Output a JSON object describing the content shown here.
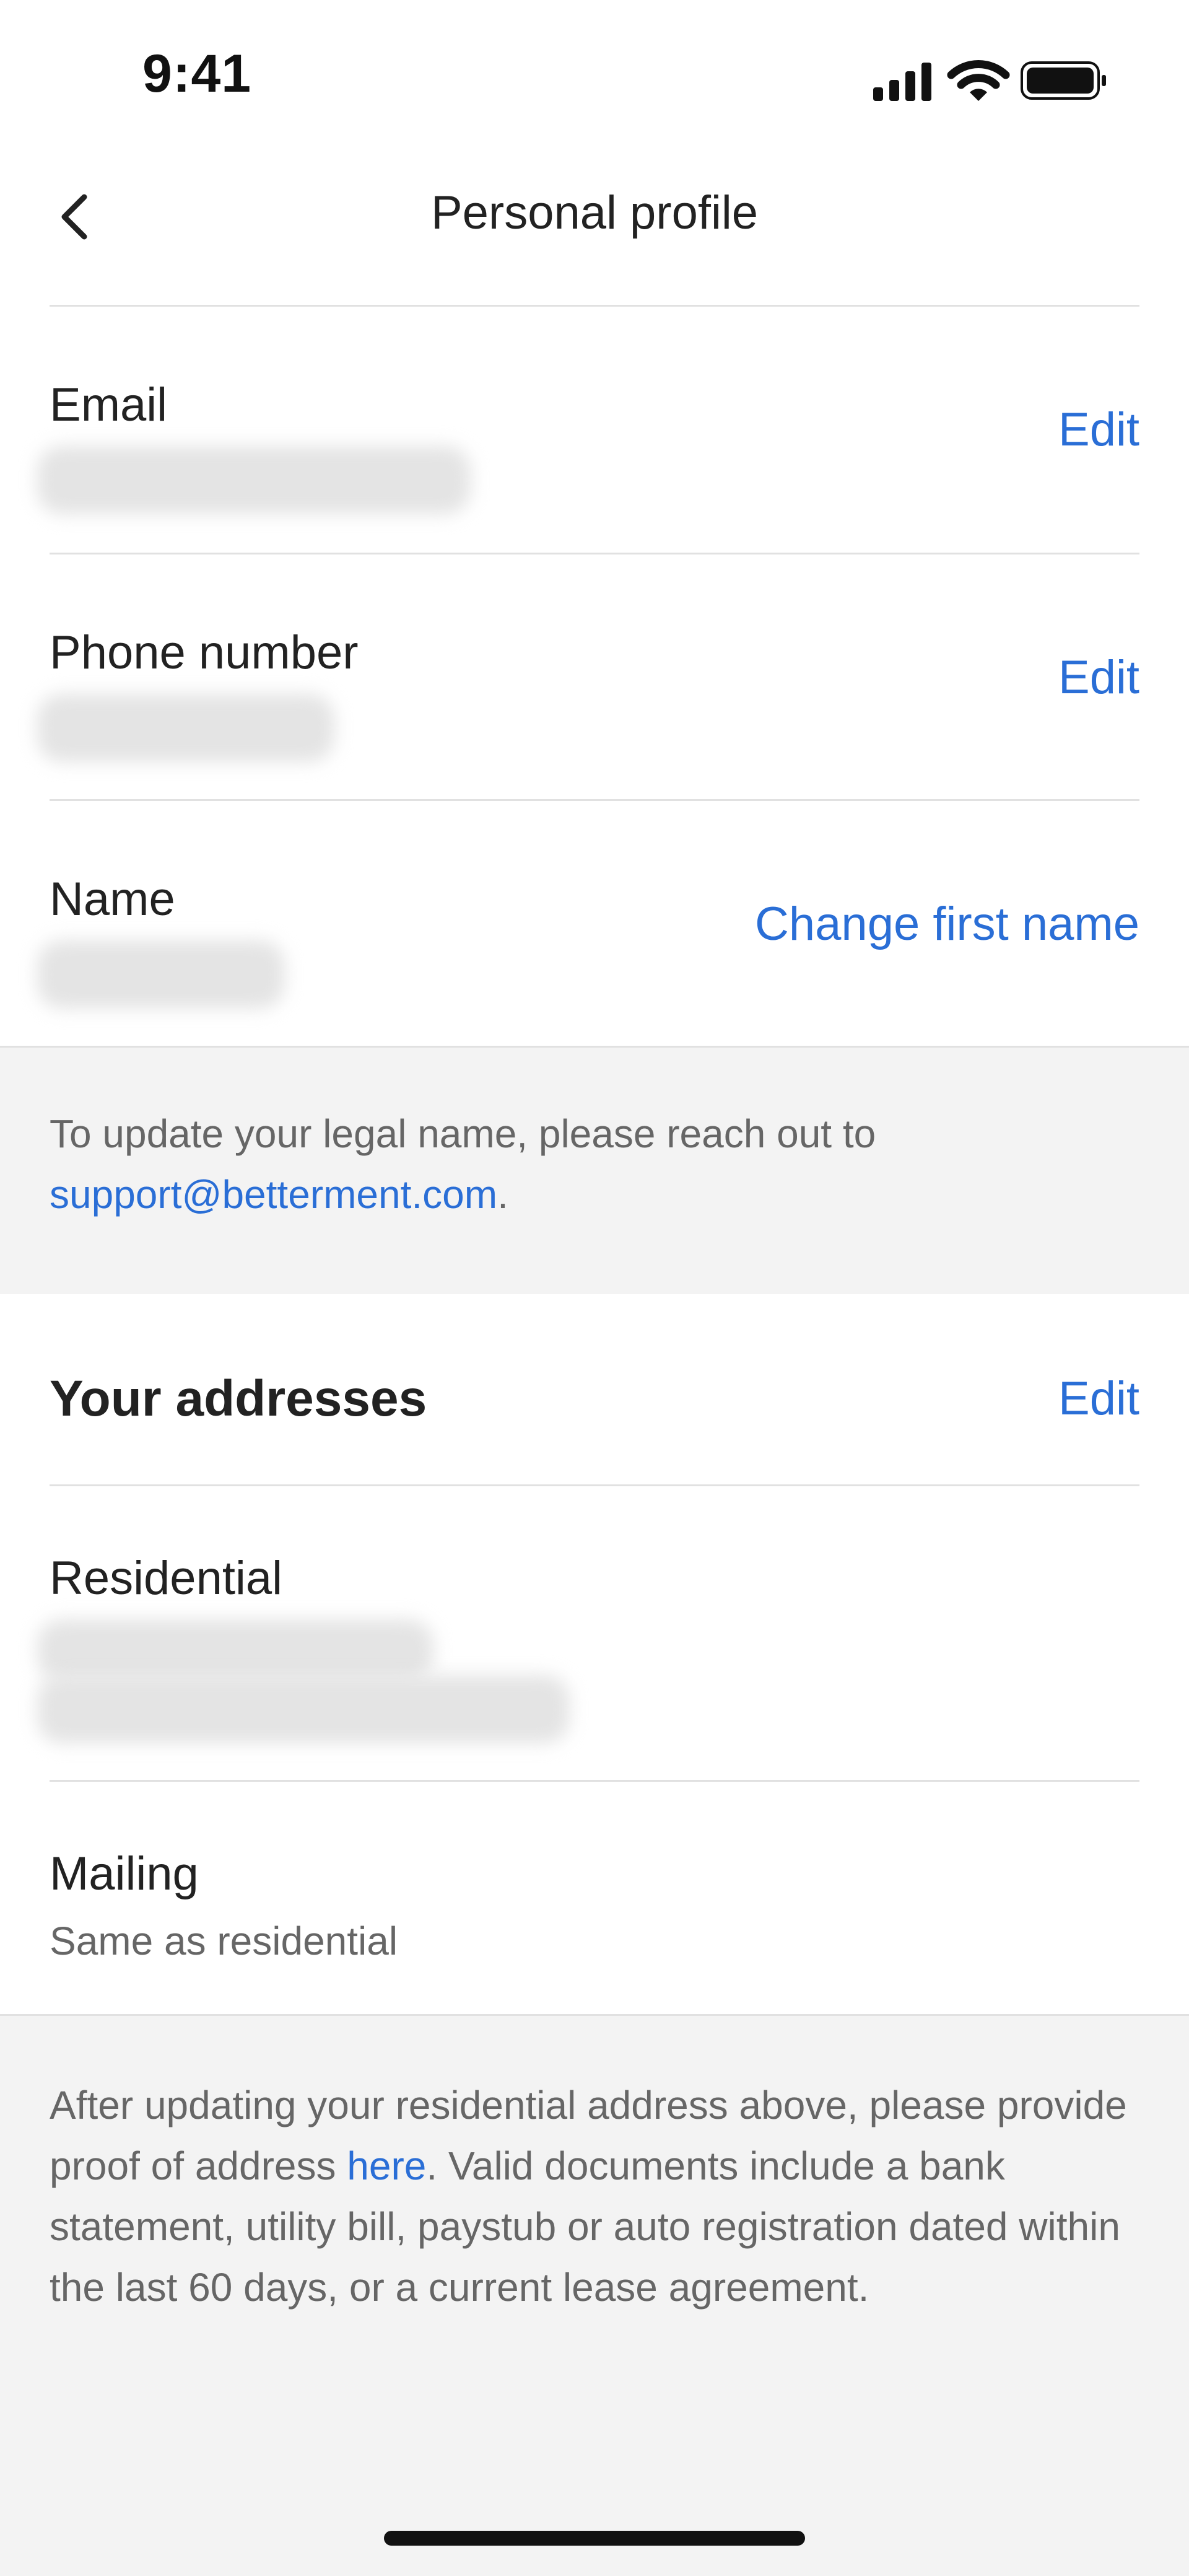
{
  "status_bar": {
    "time": "9:41",
    "icons": [
      "cellular-signal-icon",
      "wifi-icon",
      "battery-icon"
    ]
  },
  "header": {
    "title": "Personal profile",
    "back_icon": "chevron-left-icon"
  },
  "profile": {
    "email": {
      "label": "Email",
      "action": "Edit",
      "value_redacted": true
    },
    "phone": {
      "label": "Phone number",
      "action": "Edit",
      "value_redacted": true
    },
    "name": {
      "label": "Name",
      "action": "Change first name",
      "value_redacted": true
    }
  },
  "legal_name_notice": {
    "text": "To update your legal name, please reach out to",
    "email_link": "support@betterment.com",
    "suffix": "."
  },
  "addresses": {
    "title": "Your addresses",
    "action": "Edit",
    "residential": {
      "label": "Residential",
      "value_redacted": true
    },
    "mailing": {
      "label": "Mailing",
      "value": "Same as residential"
    }
  },
  "address_notice": {
    "part1": "After updating your residential address above, please provide proof of address ",
    "link": "here",
    "part2": ". Valid documents include a bank statement, utility bill, paystub or auto registration dated within the last 60 days, or a current lease agreement."
  },
  "colors": {
    "accent": "#2a6ed6",
    "text_primary": "#222222",
    "text_secondary": "#666666",
    "panel_background": "#f3f3f3",
    "divider": "#e1e1e1"
  }
}
